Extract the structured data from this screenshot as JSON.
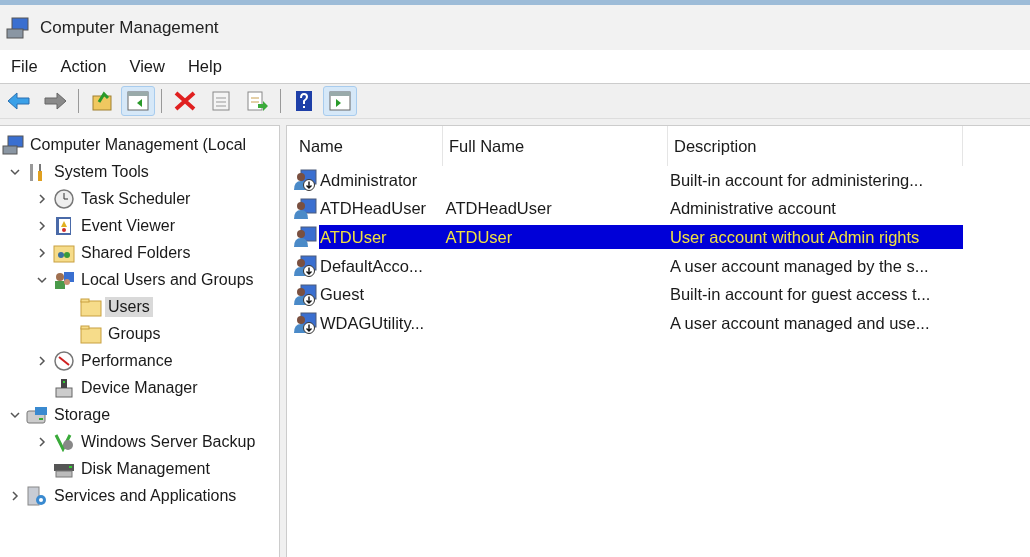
{
  "window": {
    "title": "Computer Management"
  },
  "menu": [
    "File",
    "Action",
    "View",
    "Help"
  ],
  "toolbar": [
    {
      "kind": "button",
      "pressed": false
    },
    {
      "kind": "button",
      "pressed": false
    },
    {
      "kind": "separator"
    },
    {
      "kind": "button",
      "pressed": false
    },
    {
      "kind": "button",
      "pressed": true
    },
    {
      "kind": "separator"
    },
    {
      "kind": "button",
      "pressed": false
    },
    {
      "kind": "button",
      "pressed": false
    },
    {
      "kind": "button",
      "pressed": false
    },
    {
      "kind": "separator"
    },
    {
      "kind": "button",
      "pressed": false
    },
    {
      "kind": "button",
      "pressed": true
    }
  ],
  "tree": [
    {
      "label": "Computer Management (Local",
      "selected": false,
      "children": [
        {
          "label": "System Tools",
          "selected": false,
          "expanded": true,
          "children": [
            {
              "label": "Task Scheduler",
              "selected": false,
              "expanded": false
            },
            {
              "label": "Event Viewer",
              "selected": false,
              "expanded": false
            },
            {
              "label": "Shared Folders",
              "selected": false,
              "expanded": false
            },
            {
              "label": "Local Users and Groups",
              "selected": false,
              "expanded": true,
              "children": [
                {
                  "label": "Users",
                  "selected": true
                },
                {
                  "label": "Groups",
                  "selected": false
                }
              ]
            },
            {
              "label": "Performance",
              "selected": false,
              "expanded": false
            },
            {
              "label": "Device Manager",
              "selected": false
            }
          ]
        },
        {
          "label": "Storage",
          "selected": false,
          "expanded": true,
          "children": [
            {
              "label": "Windows Server Backup",
              "selected": false,
              "expanded": false
            },
            {
              "label": "Disk Management",
              "selected": false
            }
          ]
        },
        {
          "label": "Services and Applications",
          "selected": false,
          "expanded": false
        }
      ]
    }
  ],
  "table": {
    "columns": [
      "Name",
      "Full Name",
      "Description"
    ],
    "rows": [
      {
        "name": "Administrator",
        "full_name": "",
        "description": "Built-in account for administering...",
        "disabled": true,
        "selected": false
      },
      {
        "name": "ATDHeadUser",
        "full_name": "ATDHeadUser",
        "description": "Administrative account",
        "disabled": false,
        "selected": false
      },
      {
        "name": "ATDUser",
        "full_name": "ATDUser",
        "description": "User account without Admin rights",
        "disabled": false,
        "selected": true
      },
      {
        "name": "DefaultAcco...",
        "full_name": "",
        "description": "A user account managed by the s...",
        "disabled": true,
        "selected": false
      },
      {
        "name": "Guest",
        "full_name": "",
        "description": "Built-in account for guest access t...",
        "disabled": true,
        "selected": false
      },
      {
        "name": "WDAGUtility...",
        "full_name": "",
        "description": "A user account managed and use...",
        "disabled": true,
        "selected": false
      }
    ]
  }
}
